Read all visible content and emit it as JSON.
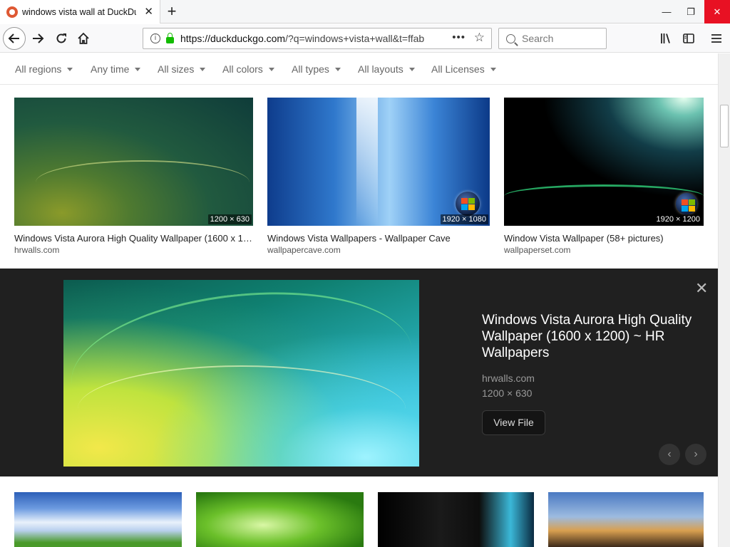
{
  "browser": {
    "tab_title": "windows vista wall at DuckDuckGo",
    "url_host": "https://duckduckgo.com",
    "url_path": "/?q=windows+vista+wall&t=ffab",
    "search_placeholder": "Search",
    "accent": "#de5833"
  },
  "filters": [
    "All regions",
    "Any time",
    "All sizes",
    "All colors",
    "All types",
    "All layouts",
    "All Licenses"
  ],
  "results_top": [
    {
      "title": "Windows Vista Aurora High Quality Wallpaper (1600 x 1200) ~ HR Wallpapers",
      "source": "hrwalls.com",
      "dims": "1200 × 630"
    },
    {
      "title": "Windows Vista Wallpapers - Wallpaper Cave",
      "source": "wallpapercave.com",
      "dims": "1920 × 1080"
    },
    {
      "title": "Window Vista Wallpaper (58+ pictures)",
      "source": "wallpaperset.com",
      "dims": "1920 × 1200"
    }
  ],
  "detail": {
    "title": "Windows Vista Aurora High Quality Wallpaper (1600 x 1200) ~ HR Wallpapers",
    "source": "hrwalls.com",
    "dims": "1200 × 630",
    "button": "View File"
  }
}
